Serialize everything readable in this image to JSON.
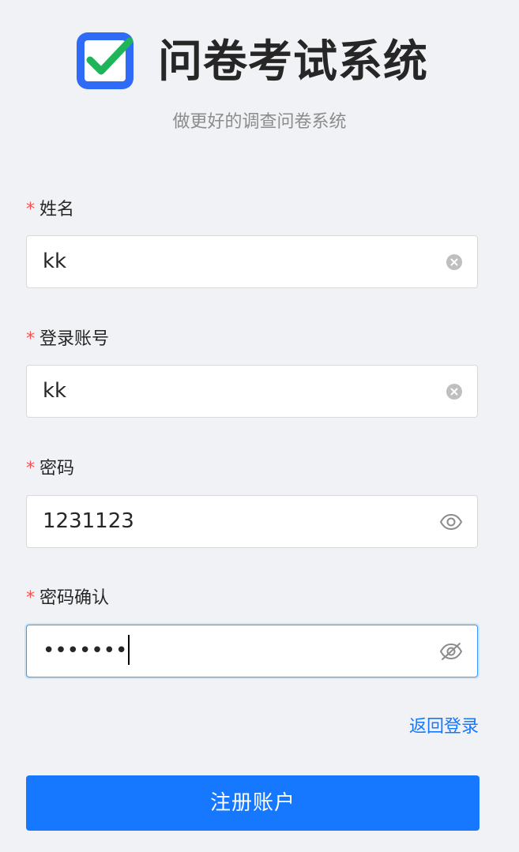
{
  "header": {
    "title": "问卷考试系统",
    "subtitle": "做更好的调查问卷系统",
    "logo_icon": "checkbox-check-icon",
    "logo_color": "#2f6bf6",
    "check_color": "#1db45a"
  },
  "form": {
    "required_mark": "*",
    "fields": [
      {
        "label": "姓名",
        "value": "kk",
        "suffix_icon": "clear-icon"
      },
      {
        "label": "登录账号",
        "value": "kk",
        "suffix_icon": "clear-icon"
      },
      {
        "label": "密码",
        "value": "1231123",
        "suffix_icon": "eye-icon"
      },
      {
        "label": "密码确认",
        "value": "•••••••",
        "suffix_icon": "eye-slash-icon"
      }
    ],
    "back_link": "返回登录",
    "submit_label": "注册账户"
  },
  "colors": {
    "primary": "#1677ff",
    "required": "#ff4d4f",
    "background": "#f0f2f5"
  }
}
